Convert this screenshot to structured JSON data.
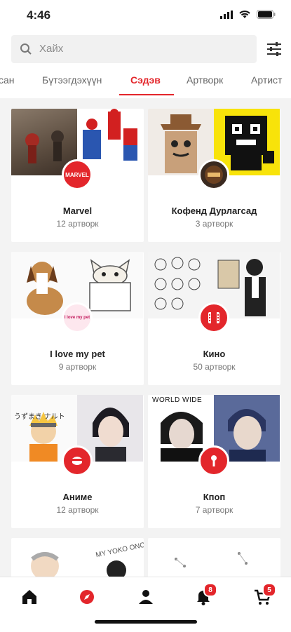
{
  "status": {
    "time": "4:46"
  },
  "search": {
    "placeholder": "Хайх"
  },
  "tabs": [
    {
      "label": "сан"
    },
    {
      "label": "Бүтээгдэхүүн"
    },
    {
      "label": "Сэдэв"
    },
    {
      "label": "Артворк"
    },
    {
      "label": "Артист"
    }
  ],
  "active_tab_index": 2,
  "topics": [
    {
      "name": "Marvel",
      "count": "12 артворк",
      "badge_text": "MARVEL"
    },
    {
      "name": "Кофенд Дурлагсад",
      "count": "3 артворк",
      "badge_text": ""
    },
    {
      "name": "I love my pet",
      "count": "9 артворк",
      "badge_text": "I love my pet"
    },
    {
      "name": "Кино",
      "count": "50 артворк",
      "badge_text": ""
    },
    {
      "name": "Аниме",
      "count": "12 артворк",
      "badge_text": ""
    },
    {
      "name": "Кпоп",
      "count": "7 артворк",
      "badge_text": ""
    }
  ],
  "thumb_texts": {
    "naruto": "うずまき ナルト",
    "kpop": "WORLD WIDE",
    "bottom_script": "MY YOKO ONO"
  },
  "bottom_nav": {
    "items": [
      {
        "icon": "home-icon"
      },
      {
        "icon": "explore-icon"
      },
      {
        "icon": "profile-icon"
      },
      {
        "icon": "bell-icon",
        "badge": "8"
      },
      {
        "icon": "cart-icon",
        "badge": "5"
      }
    ]
  },
  "colors": {
    "accent": "#e3262b",
    "background": "#f3f3f3"
  }
}
